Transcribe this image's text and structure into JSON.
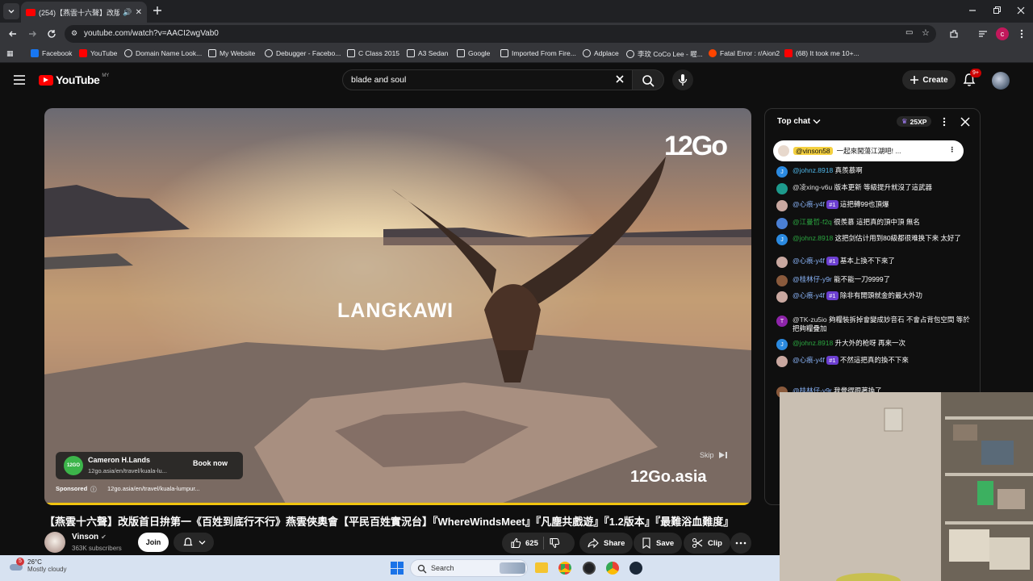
{
  "browser": {
    "tab_title": "(254)【燕雲十六聲】改版首日",
    "url": "youtube.com/watch?v=AACI2wgVab0",
    "bookmarks": [
      "Facebook",
      "YouTube",
      "Domain Name Look...",
      "My Website",
      "Debugger - Facebo...",
      "C Class 2015",
      "A3 Sedan",
      "Google",
      "Imported From Fire...",
      "Adplace",
      "李玟 CoCo Lee - 喔...",
      "Fatal Error : r/Aion2",
      "(68) It took me 10+..."
    ],
    "profile_initial": "c"
  },
  "youtube": {
    "logo": "YouTube",
    "logo_region": "MY",
    "search_value": "blade and soul",
    "create_label": "Create",
    "notif_count": "9+"
  },
  "video": {
    "overlay_location": "LANGKAWI",
    "brand_top": "12Go",
    "brand_bottom": "12Go.asia",
    "skip_label": "Skip",
    "sponsor": {
      "name": "Cameron H.Lands",
      "url": "12go.asia/en/travel/kuala-lu...",
      "cta": "Book now",
      "sponsored_label": "Sponsored",
      "footer_url": "12go.asia/en/travel/kuala-lumpur..."
    },
    "progress": 1.0
  },
  "chat": {
    "header": "Top chat",
    "xp": "25XP",
    "pinned": {
      "author": "@vinson58",
      "text": "一起來闖蕩江湖吧! ..."
    },
    "messages": [
      {
        "author": "@johnz.8918",
        "text": "真羨慕啊",
        "avatar": "J",
        "color": "#2b8ae0"
      },
      {
        "author": "@凌xing-v6u",
        "text": "版本更新 等級提升就沒了這武器",
        "avatar": "",
        "color": "#1d9a8c"
      },
      {
        "author": "@心痕-y4f",
        "badge": "#1",
        "text": "這把轉99也頂爆",
        "avatar": "",
        "color": "#c9a8a0"
      },
      {
        "author": "@江曼哲-f2q",
        "text": "很羨慕 這把真的頂中頂 無名",
        "avatar": "",
        "color": "#4a7fd4"
      },
      {
        "author": "@johnz.8918",
        "text": "这把剑估计用到80級都很难换下来 太好了",
        "avatar": "J",
        "color": "#2b8ae0"
      },
      {
        "author": "@心痕-y4f",
        "badge": "#1",
        "text": "基本上換不下來了",
        "avatar": "",
        "color": "#c9a8a0"
      },
      {
        "author": "@桂林仔-y9r",
        "text": "能不能一刀9999了",
        "avatar": "",
        "color": "#8a5a3c"
      },
      {
        "author": "@心痕-y4f",
        "badge": "#1",
        "text": "除非有開頭就金的最大外功",
        "avatar": "",
        "color": "#c9a8a0"
      },
      {
        "author": "@TK-zu5io",
        "text": "夠糧裝拆掉會變成妙音石 不會占背包空間 等於把夠糧疊加",
        "avatar": "T",
        "color": "#8e24aa"
      },
      {
        "author": "@johnz.8918",
        "text": "升大外的枪呀 再来一次",
        "avatar": "J",
        "color": "#2b8ae0"
      },
      {
        "author": "@心痕-y4f",
        "badge": "#1",
        "text": "不然這把真的換不下來",
        "avatar": "",
        "color": "#c9a8a0"
      },
      {
        "author": "@桂林仔-y9r",
        "text": "我覺得跟著換了",
        "avatar": "",
        "color": "#8a5a3c"
      }
    ]
  },
  "below": {
    "title": "【燕雲十六聲】改版首日拚第一《百姓到底行不行》燕雲俠奧會【平民百姓實況台】『WhereWindsMeet』『凡塵共戲遊』『1.2版本』『最難浴血難度』",
    "channel": "Vinson",
    "subscribers": "363K subscribers",
    "join": "Join",
    "likes": "625",
    "share": "Share",
    "save": "Save",
    "clip": "Clip"
  },
  "taskbar": {
    "temp": "26°C",
    "weather": "Mostly cloudy",
    "search": "Search",
    "notif_badge": "5"
  }
}
